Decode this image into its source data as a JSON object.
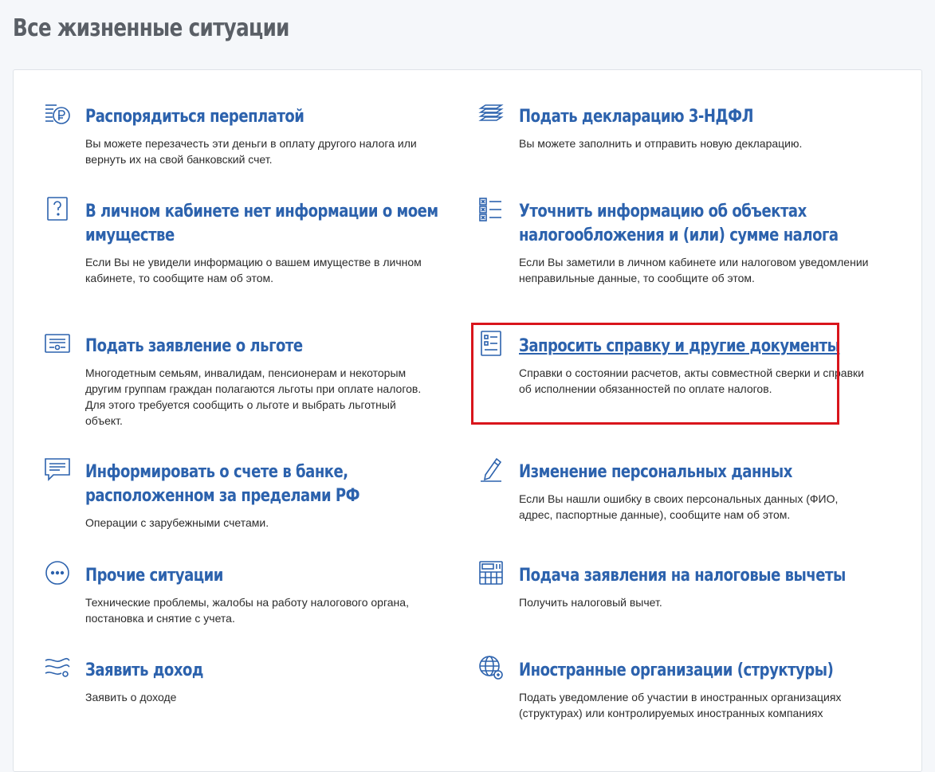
{
  "page": {
    "title": "Все жизненные ситуации"
  },
  "situations": [
    {
      "title": "Распорядиться переплатой",
      "desc": "Вы можете перезачесть эти деньги в оплату другого налога или вернуть их на свой банковский счет.",
      "icon": "ruble-coins-icon"
    },
    {
      "title": "Подать декларацию 3-НДФЛ",
      "desc": "Вы можете заполнить и отправить новую декларацию.",
      "icon": "declaration-stack-icon"
    },
    {
      "title": "В личном кабинете нет информации о моем имуществе",
      "desc": "Если Вы не увидели информацию о вашем имуществе в личном кабинете, то сообщите нам об этом.",
      "icon": "question-document-icon"
    },
    {
      "title": "Уточнить информацию об объектах налогообложения и (или) сумме налога",
      "desc": "Если Вы заметили в личном кабинете или налоговом уведомлении неправильные данные, то сообщите об этом.",
      "icon": "checklist-icon"
    },
    {
      "title": "Подать заявление о льготе",
      "desc": "Многодетным семьям, инвалидам, пенсионерам и некоторым другим группам граждан полагаются льготы при оплате налогов. Для этого требуется сообщить о льготе и выбрать льготный объект.",
      "icon": "certificate-icon"
    },
    {
      "title": "Запросить справку и другие документы",
      "desc": "Справки о состоянии расчетов, акты совместной сверки и справки об исполнении обязанностей по оплате налогов.",
      "icon": "document-list-icon"
    },
    {
      "title": "Информировать о счете в банке, расположенном за пределами РФ",
      "desc": "Операции с зарубежными счетами.",
      "icon": "chat-message-icon"
    },
    {
      "title": "Изменение персональных данных",
      "desc": "Если Вы нашли ошибку в своих персональных данных (ФИО, адрес, паспортные данные), сообщите нам об этом.",
      "icon": "pencil-icon"
    },
    {
      "title": "Прочие ситуации",
      "desc": "Технические проблемы, жалобы на работу налогового органа, постановка и снятие с учета.",
      "icon": "more-dots-icon"
    },
    {
      "title": "Подача заявления на налоговые вычеты",
      "desc": "Получить налоговый вычет.",
      "icon": "calculator-icon"
    },
    {
      "title": "Заявить доход",
      "desc": "Заявить о доходе",
      "icon": "income-flow-icon"
    },
    {
      "title": "Иностранные организации (структуры)",
      "desc": "Подать уведомление об участии в иностранных организациях (структурах) или контролируемых иностранных компаниях",
      "icon": "globe-icon"
    }
  ],
  "colors": {
    "title": "#2c62ad",
    "highlight": "#d9151c",
    "icon": "#2c62ad"
  }
}
